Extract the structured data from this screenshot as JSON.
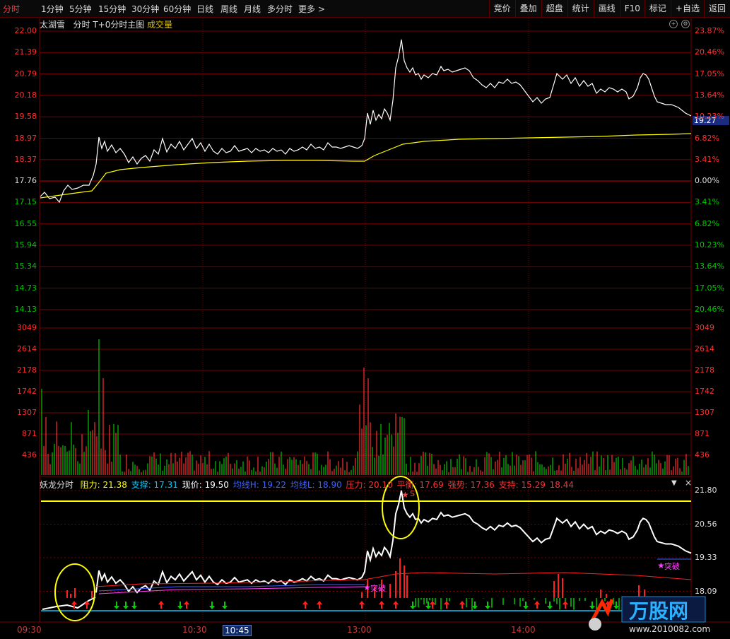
{
  "toolbar": {
    "tabs": [
      "分时",
      "1分钟",
      "5分钟",
      "15分钟",
      "30分钟",
      "60分钟",
      "日线",
      "周线",
      "月线",
      "多分时",
      "更多 >"
    ],
    "active_tab": "分时",
    "right_buttons": [
      "竞价",
      "叠加",
      "超盘",
      "统计",
      "画线",
      "F10",
      "标记",
      "+自选",
      "返回"
    ]
  },
  "main_chart": {
    "stock_name": "太湖雪",
    "mode_label": "分时",
    "subtitle": "T+0分时主图",
    "volume_label": "成交量",
    "price_ticks": [
      "22.00",
      "21.39",
      "20.79",
      "20.18",
      "19.58",
      "18.97",
      "18.37",
      "17.76",
      "17.15",
      "16.55",
      "15.94",
      "15.34",
      "14.73",
      "14.13"
    ],
    "pct_ticks": [
      "23.87%",
      "20.46%",
      "17.05%",
      "13.64%",
      "10.23%",
      "6.82%",
      "3.41%",
      "0.00%",
      "3.41%",
      "6.82%",
      "10.23%",
      "13.64%",
      "17.05%",
      "20.46%"
    ],
    "current_price_tag": "19.27",
    "volume_ticks": [
      "3049",
      "2614",
      "2178",
      "1742",
      "1307",
      "871",
      "436"
    ]
  },
  "indicator": {
    "name": "妖龙分时",
    "fields": [
      {
        "label": "阻力:",
        "value": "21.38",
        "color": "#ffff00"
      },
      {
        "label": "支撑:",
        "value": "17.31",
        "color": "#00c8ff"
      },
      {
        "label": "现价:",
        "value": "19.50",
        "color": "#ffffff"
      },
      {
        "label": "均线H:",
        "value": "19.22",
        "color": "#4060ff"
      },
      {
        "label": "均线L:",
        "value": "18.90",
        "color": "#4060ff"
      },
      {
        "label": "压力:",
        "value": "20.10",
        "color": "#ff3030"
      },
      {
        "label": "平衡:",
        "value": "17.69",
        "color": "#ff3030"
      },
      {
        "label": "强势:",
        "value": "17.36",
        "color": "#ff3030"
      },
      {
        "label": "支持:",
        "value": "15.29",
        "color": "#ff3030"
      },
      {
        "label": "",
        "value": "18.44",
        "color": "#ff3030"
      }
    ],
    "ticks": [
      "21.80",
      "20.56",
      "19.33",
      "18.09"
    ],
    "signal_breakout": "突破",
    "signal_s": "S",
    "menu_arrow": "▼",
    "close": "×"
  },
  "time_axis": [
    "09:30",
    "10:30",
    "10:45",
    "13:00",
    "14:00"
  ],
  "time_selected": "10:45",
  "colors": {
    "up": "#ff3030",
    "down": "#00c800",
    "grid": "#7a0000",
    "price": "#ffffff",
    "avg": "#ffff00"
  }
}
